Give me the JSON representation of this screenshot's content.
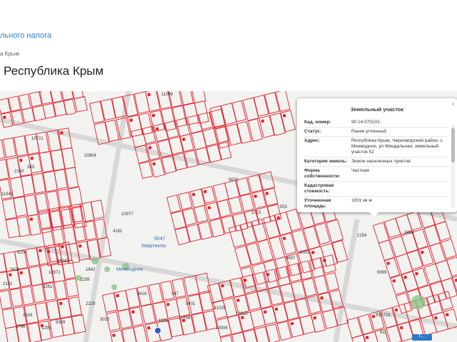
{
  "header": {
    "top_link": "льного налога",
    "breadcrumb": "а Крым",
    "title": "Республика Крым"
  },
  "popup": {
    "title": "Земельный участок",
    "close": "×",
    "rows": [
      {
        "label": "Кад. номер:",
        "value": "90:14:070101:"
      },
      {
        "label": "Статус:",
        "value": "Ранее учтенный"
      },
      {
        "label": "Адрес:",
        "value": "Республика Крым, Черноморский район, с Межводное, ул Миндальная, земельный участок 52"
      },
      {
        "label": "Категория земель:",
        "value": "Земли населенных пунктов"
      },
      {
        "label": "Форма собственности:",
        "value": "Частная"
      },
      {
        "label": "Кадастровая стоимость:",
        "value": ""
      },
      {
        "label": "Уточненная площадь:",
        "value": "1001 кв м"
      }
    ]
  },
  "map": {
    "route_badge": "Т-...",
    "labels": [
      "Квартиклы",
      "Межводное",
      "9047"
    ],
    "parcel_numbers": [
      "11099",
      "10721",
      "383",
      "10904",
      "2140",
      "9670",
      "1023",
      "553",
      "2154",
      "3499",
      "9697",
      "1001",
      "8990",
      "11642",
      "9204",
      "3426",
      "2131",
      "10371",
      "1842",
      "2239",
      "3261",
      "4181",
      "10977",
      "9999",
      "1626",
      "10187",
      "2229",
      "3015",
      "1796",
      "9309",
      "1295",
      "9401",
      "10756",
      "11025",
      "13006",
      "1526",
      "13015",
      "347",
      "3418",
      "911 721",
      "911"
    ]
  },
  "colors": {
    "parcel_stroke": "#e0202a",
    "popup_bg": "#ffffff",
    "link": "#2a7fc6"
  }
}
